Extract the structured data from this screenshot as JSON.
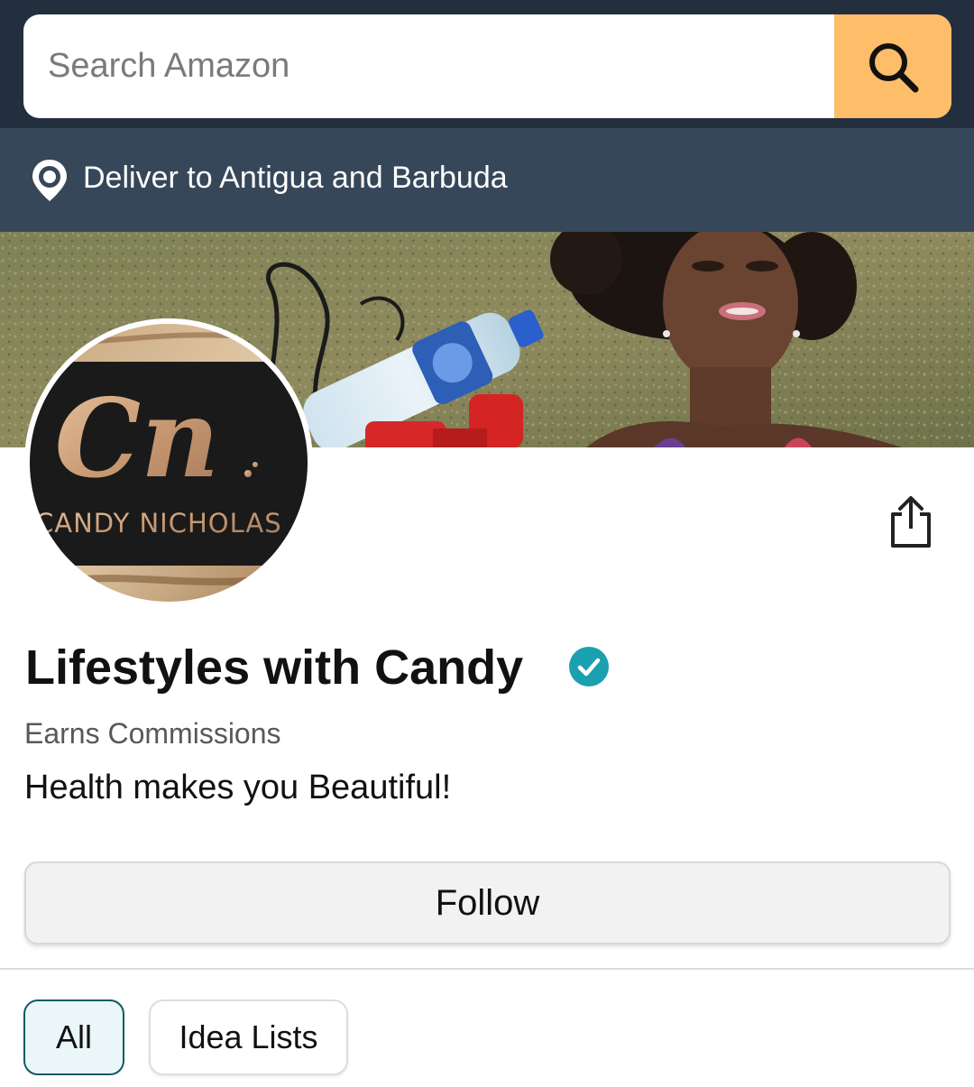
{
  "search": {
    "placeholder": "Search Amazon",
    "button_color": "#febd69"
  },
  "header": {
    "bar_color": "#232f3e",
    "deliver_bar_color": "#37475a"
  },
  "delivery": {
    "label": "Deliver to Antigua and Barbuda",
    "icon": "location-pin-icon"
  },
  "avatar": {
    "logo_letters": "Cn",
    "logo_name": "CANDY NICHOLAS"
  },
  "profile": {
    "name": "Lifestyles with Candy",
    "verified_icon": "verified-check-icon",
    "verified_color": "#1ba0b0",
    "status": "Earns Commissions",
    "bio": "Health makes you Beautiful!",
    "share_icon": "share-icon"
  },
  "actions": {
    "follow_label": "Follow"
  },
  "tabs": [
    {
      "label": "All",
      "selected": true
    },
    {
      "label": "Idea Lists",
      "selected": false
    }
  ]
}
